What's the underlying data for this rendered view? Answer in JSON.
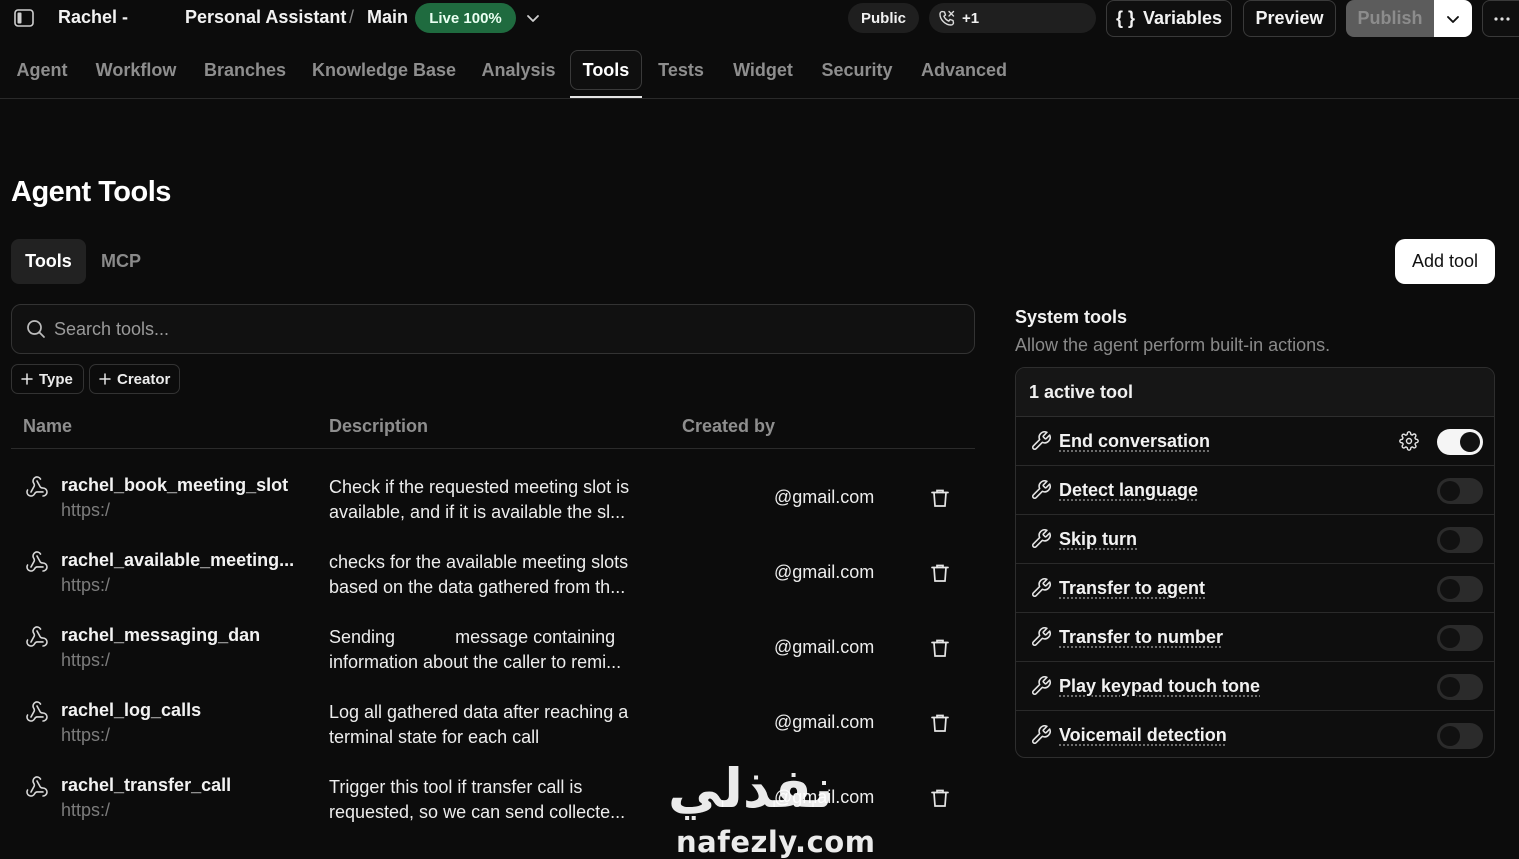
{
  "header": {
    "agent_name": "Rachel -",
    "project": "Personal Assistant",
    "separator": "/",
    "branch": "Main",
    "live_badge": "Live 100%",
    "visibility": "Public",
    "phone_count": "+1",
    "variables_label": "Variables",
    "variables_icon": "{ }",
    "preview_label": "Preview",
    "publish_label": "Publish"
  },
  "tabs": [
    {
      "label": "Agent"
    },
    {
      "label": "Workflow"
    },
    {
      "label": "Branches"
    },
    {
      "label": "Knowledge Base"
    },
    {
      "label": "Analysis"
    },
    {
      "label": "Tools",
      "active": true
    },
    {
      "label": "Tests"
    },
    {
      "label": "Widget"
    },
    {
      "label": "Security"
    },
    {
      "label": "Advanced"
    }
  ],
  "page": {
    "title": "Agent Tools",
    "segments": [
      "Tools",
      "MCP"
    ],
    "add_tool_label": "Add tool"
  },
  "search": {
    "placeholder": "Search tools..."
  },
  "filters": [
    "Type",
    "Creator"
  ],
  "table": {
    "columns": [
      "Name",
      "Description",
      "Created by"
    ],
    "rows": [
      {
        "name": "rachel_book_meeting_slot",
        "url": "https:/",
        "desc": "Check if the requested meeting slot is available, and if it is available the sl...",
        "creator": "@gmail.com"
      },
      {
        "name": "rachel_available_meeting...",
        "url": "https:/",
        "desc": "checks for the available meeting slots based on the data gathered from th...",
        "creator": "@gmail.com"
      },
      {
        "name": "rachel_messaging_dan",
        "url": "https:/",
        "desc": "Sending            message containing information about the caller to remi...",
        "creator": "@gmail.com"
      },
      {
        "name": "rachel_log_calls",
        "url": "https:/",
        "desc": "Log all gathered data after reaching a terminal state for each call",
        "creator": "@gmail.com"
      },
      {
        "name": "rachel_transfer_call",
        "url": "https:/",
        "desc": "Trigger this tool if transfer call is requested, so we can send collecte...",
        "creator": "@gmail.com"
      }
    ]
  },
  "system_tools": {
    "title": "System tools",
    "subtitle": "Allow the agent perform built-in actions.",
    "active_summary": "1 active tool",
    "items": [
      {
        "label": "End conversation",
        "enabled": true,
        "has_settings": true
      },
      {
        "label": "Detect language",
        "enabled": false
      },
      {
        "label": "Skip turn",
        "enabled": false
      },
      {
        "label": "Transfer to agent",
        "enabled": false
      },
      {
        "label": "Transfer to number",
        "enabled": false
      },
      {
        "label": "Play keypad touch tone",
        "enabled": false
      },
      {
        "label": "Voicemail detection",
        "enabled": false
      }
    ]
  },
  "watermark": {
    "arabic": "نفذلي",
    "latin": "nafezly.com"
  },
  "colors": {
    "live_green": "#1f6b3f",
    "background": "#0c0c0c"
  },
  "icons": {
    "row": "webhook-icon",
    "trash": "trash-icon",
    "tool": "wrench-icon",
    "settings": "gear-icon",
    "search": "search-icon",
    "add": "plus-icon",
    "phone": "phone-icon"
  }
}
